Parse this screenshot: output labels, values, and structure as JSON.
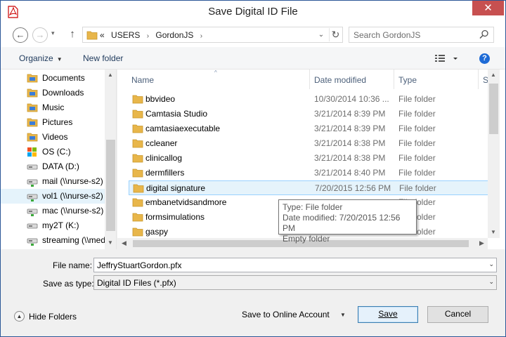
{
  "window": {
    "title": "Save Digital ID File",
    "close_glyph": "✕"
  },
  "navbar": {
    "back_glyph": "←",
    "forward_glyph": "→",
    "recent_glyph": "▾",
    "up_glyph": "↑",
    "address": {
      "prefix": "«",
      "crumbs": [
        "USERS",
        "GordonJS"
      ],
      "sep": "›"
    },
    "dropdown_glyph": "⌄",
    "refresh_glyph": "↻",
    "search_placeholder": "Search GordonJS"
  },
  "toolbar": {
    "organize": "Organize",
    "new_folder": "New folder",
    "caret": "▼",
    "help_glyph": "?"
  },
  "navpane": {
    "items": [
      {
        "label": "Documents",
        "icon": "documents-folder-icon",
        "selected": false
      },
      {
        "label": "Downloads",
        "icon": "downloads-folder-icon",
        "selected": false
      },
      {
        "label": "Music",
        "icon": "music-folder-icon",
        "selected": false
      },
      {
        "label": "Pictures",
        "icon": "pictures-folder-icon",
        "selected": false
      },
      {
        "label": "Videos",
        "icon": "videos-folder-icon",
        "selected": false
      },
      {
        "label": "OS (C:)",
        "icon": "os-drive-icon",
        "selected": false
      },
      {
        "label": "DATA (D:)",
        "icon": "drive-icon",
        "selected": false
      },
      {
        "label": "mail (\\\\nurse-s2)",
        "icon": "network-drive-icon",
        "selected": false
      },
      {
        "label": "vol1 (\\\\nurse-s2)",
        "icon": "network-drive-icon",
        "selected": true
      },
      {
        "label": "mac (\\\\nurse-s2)",
        "icon": "network-drive-icon",
        "selected": false
      },
      {
        "label": "my2T (K:)",
        "icon": "drive-icon",
        "selected": false
      },
      {
        "label": "streaming (\\\\med",
        "icon": "network-drive-icon",
        "selected": false
      }
    ]
  },
  "columns": {
    "name": "Name",
    "date": "Date modified",
    "type": "Type",
    "size": "Si",
    "sort_glyph": "^"
  },
  "files": [
    {
      "name": "bbvideo",
      "date": "10/30/2014 10:36 ...",
      "type": "File folder",
      "selected": false
    },
    {
      "name": "Camtasia Studio",
      "date": "3/21/2014 8:39 PM",
      "type": "File folder",
      "selected": false
    },
    {
      "name": "camtasiaexecutable",
      "date": "3/21/2014 8:39 PM",
      "type": "File folder",
      "selected": false
    },
    {
      "name": "ccleaner",
      "date": "3/21/2014 8:38 PM",
      "type": "File folder",
      "selected": false
    },
    {
      "name": "clinicallog",
      "date": "3/21/2014 8:38 PM",
      "type": "File folder",
      "selected": false
    },
    {
      "name": "dermfillers",
      "date": "3/21/2014 8:40 PM",
      "type": "File folder",
      "selected": false
    },
    {
      "name": "digital signature",
      "date": "7/20/2015 12:56 PM",
      "type": "File folder",
      "selected": true
    },
    {
      "name": "embanetvidsandmore",
      "date": "",
      "type": "File folder",
      "selected": false
    },
    {
      "name": "formsimulations",
      "date": "",
      "type": "File folder",
      "selected": false
    },
    {
      "name": "gaspy",
      "date": "",
      "type": "File folder",
      "selected": false
    }
  ],
  "tooltip": {
    "type_line": "Type: File folder",
    "date_line": "Date modified: 7/20/2015 12:56 PM",
    "empty_line": "Empty folder"
  },
  "form": {
    "file_name_label": "File name:",
    "file_name_value": "JeffryStuartGordon.pfx",
    "save_type_label": "Save as type:",
    "save_type_value": "Digital ID Files (*.pfx)",
    "dropdown_glyph": "⌄"
  },
  "footer": {
    "hide_folders": "Hide Folders",
    "hide_glyph": "▲",
    "online_account": "Save to Online Account",
    "online_caret": "▼",
    "save": "Save",
    "cancel": "Cancel"
  },
  "colors": {
    "accent": "#1e6bd6",
    "close": "#c75050",
    "selection": "#e5f3fb",
    "folder": "#e8b64a"
  }
}
